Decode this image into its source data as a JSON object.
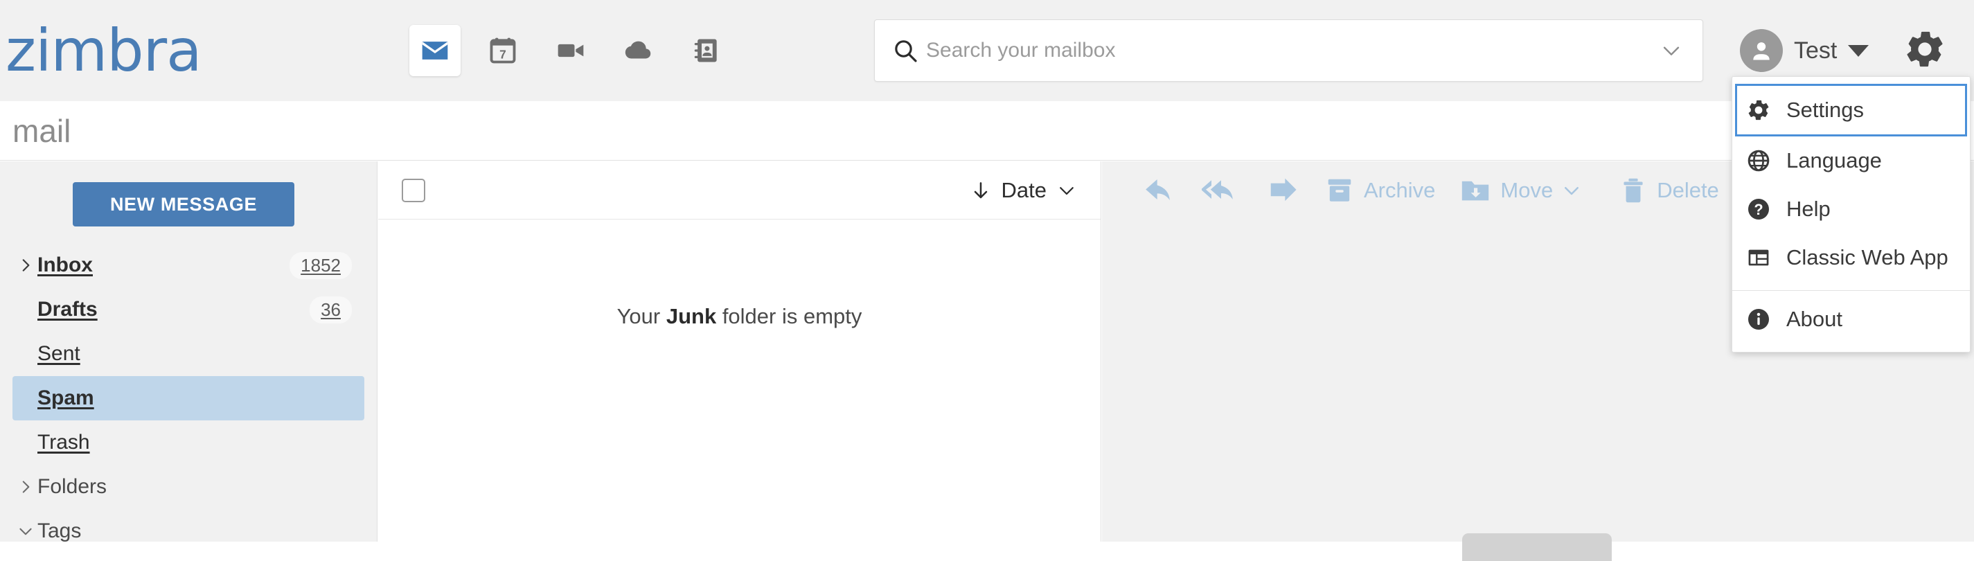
{
  "brand": {
    "logo_text": "zimbra",
    "accent_color": "#4a7db5"
  },
  "header": {
    "apps": [
      {
        "name": "mail-app-icon",
        "label": "Mail",
        "active": true
      },
      {
        "name": "calendar-app-icon",
        "label": "Calendar",
        "day": "7",
        "active": false
      },
      {
        "name": "video-app-icon",
        "label": "Video",
        "active": false
      },
      {
        "name": "briefcase-cloud-app-icon",
        "label": "Drive",
        "active": false
      },
      {
        "name": "contacts-app-icon",
        "label": "Contacts",
        "active": false
      }
    ],
    "search": {
      "placeholder": "Search your mailbox",
      "value": "",
      "icon": "search-icon",
      "expand_icon": "chevron-down-icon"
    },
    "user": {
      "name": "Test",
      "avatar_icon": "person-icon",
      "caret_icon": "caret-down-icon"
    },
    "settings_icon": "gear-icon"
  },
  "app_title": "mail",
  "sidebar": {
    "new_message_label": "NEW MESSAGE",
    "folders": [
      {
        "label": "Inbox",
        "count": "1852",
        "bold": true,
        "chevron": "chevron-right-icon",
        "selected": false
      },
      {
        "label": "Drafts",
        "count": "36",
        "bold": true,
        "chevron": "",
        "selected": false
      },
      {
        "label": "Sent",
        "count": "",
        "bold": false,
        "chevron": "",
        "selected": false
      },
      {
        "label": "Spam",
        "count": "",
        "bold": true,
        "chevron": "",
        "selected": true
      },
      {
        "label": "Trash",
        "count": "",
        "bold": false,
        "chevron": "",
        "selected": false
      },
      {
        "label": "Folders",
        "count": "",
        "bold": false,
        "chevron": "chevron-right-icon",
        "selected": false
      },
      {
        "label": "Tags",
        "count": "",
        "bold": false,
        "chevron": "chevron-down-icon",
        "selected": false
      }
    ]
  },
  "message_list": {
    "select_all_checked": false,
    "sort_direction_icon": "arrow-down-icon",
    "sort_label": "Date",
    "sort_caret_icon": "chevron-down-icon",
    "empty_prefix": "Your ",
    "empty_folder": "Junk",
    "empty_suffix": " folder is empty"
  },
  "reading_pane": {
    "toolbar": [
      {
        "name": "reply-button",
        "label": "",
        "icon": "reply-icon"
      },
      {
        "name": "reply-all-button",
        "label": "",
        "icon": "reply-all-icon"
      },
      {
        "name": "forward-button",
        "label": "",
        "icon": "forward-icon"
      },
      {
        "name": "archive-button",
        "label": "Archive",
        "icon": "archive-icon"
      },
      {
        "name": "move-button",
        "label": "Move",
        "icon": "move-folder-icon"
      },
      {
        "name": "delete-button",
        "label": "Delete",
        "icon": "trash-icon"
      },
      {
        "name": "more-button",
        "label": "",
        "icon": "more-horizontal-icon"
      }
    ],
    "disabled_color": "#a9c6e0"
  },
  "dropdown": {
    "items": [
      {
        "label": "Settings",
        "icon": "gear-icon",
        "focused": true,
        "separator_before": false
      },
      {
        "label": "Language",
        "icon": "globe-icon",
        "focused": false,
        "separator_before": false
      },
      {
        "label": "Help",
        "icon": "help-circle-icon",
        "focused": false,
        "separator_before": false
      },
      {
        "label": "Classic Web App",
        "icon": "layout-panel-icon",
        "focused": false,
        "separator_before": false
      },
      {
        "label": "About",
        "icon": "info-circle-icon",
        "focused": false,
        "separator_before": true
      }
    ]
  }
}
